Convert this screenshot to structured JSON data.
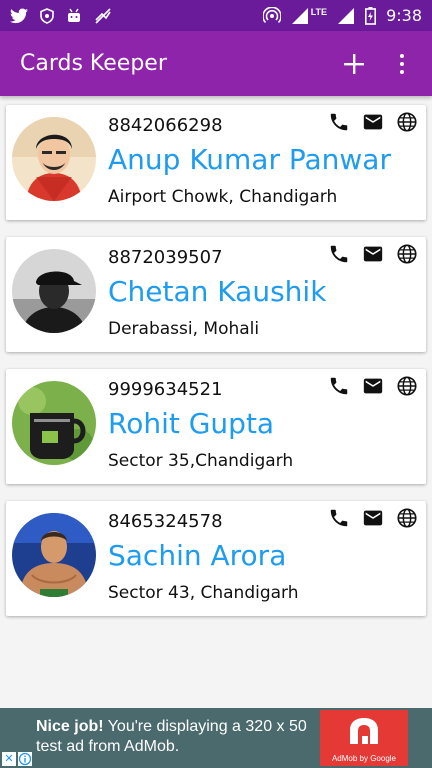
{
  "status_bar": {
    "time": "9:38",
    "network": "LTE"
  },
  "app_bar": {
    "title": "Cards Keeper",
    "add_icon": "plus-icon",
    "menu_icon": "more-vert-icon"
  },
  "colors": {
    "primary": "#8e24aa",
    "primary_dark": "#6a1b9a",
    "name_accent": "#1e9cf0"
  },
  "cards": [
    {
      "phone": "8842066298",
      "name": "Anup Kumar Panwar",
      "address": "Airport Chowk, Chandigarh"
    },
    {
      "phone": "8872039507",
      "name": "Chetan Kaushik",
      "address": "Derabassi, Mohali"
    },
    {
      "phone": "9999634521",
      "name": "Rohit Gupta",
      "address": "Sector 35,Chandigarh"
    },
    {
      "phone": "8465324578",
      "name": "Sachin Arora",
      "address": "Sector 43, Chandigarh"
    }
  ],
  "ad": {
    "headline": "Nice job!",
    "body": "You're displaying a 320 x 50 test ad from AdMob.",
    "caption": "AdMob by Google"
  }
}
